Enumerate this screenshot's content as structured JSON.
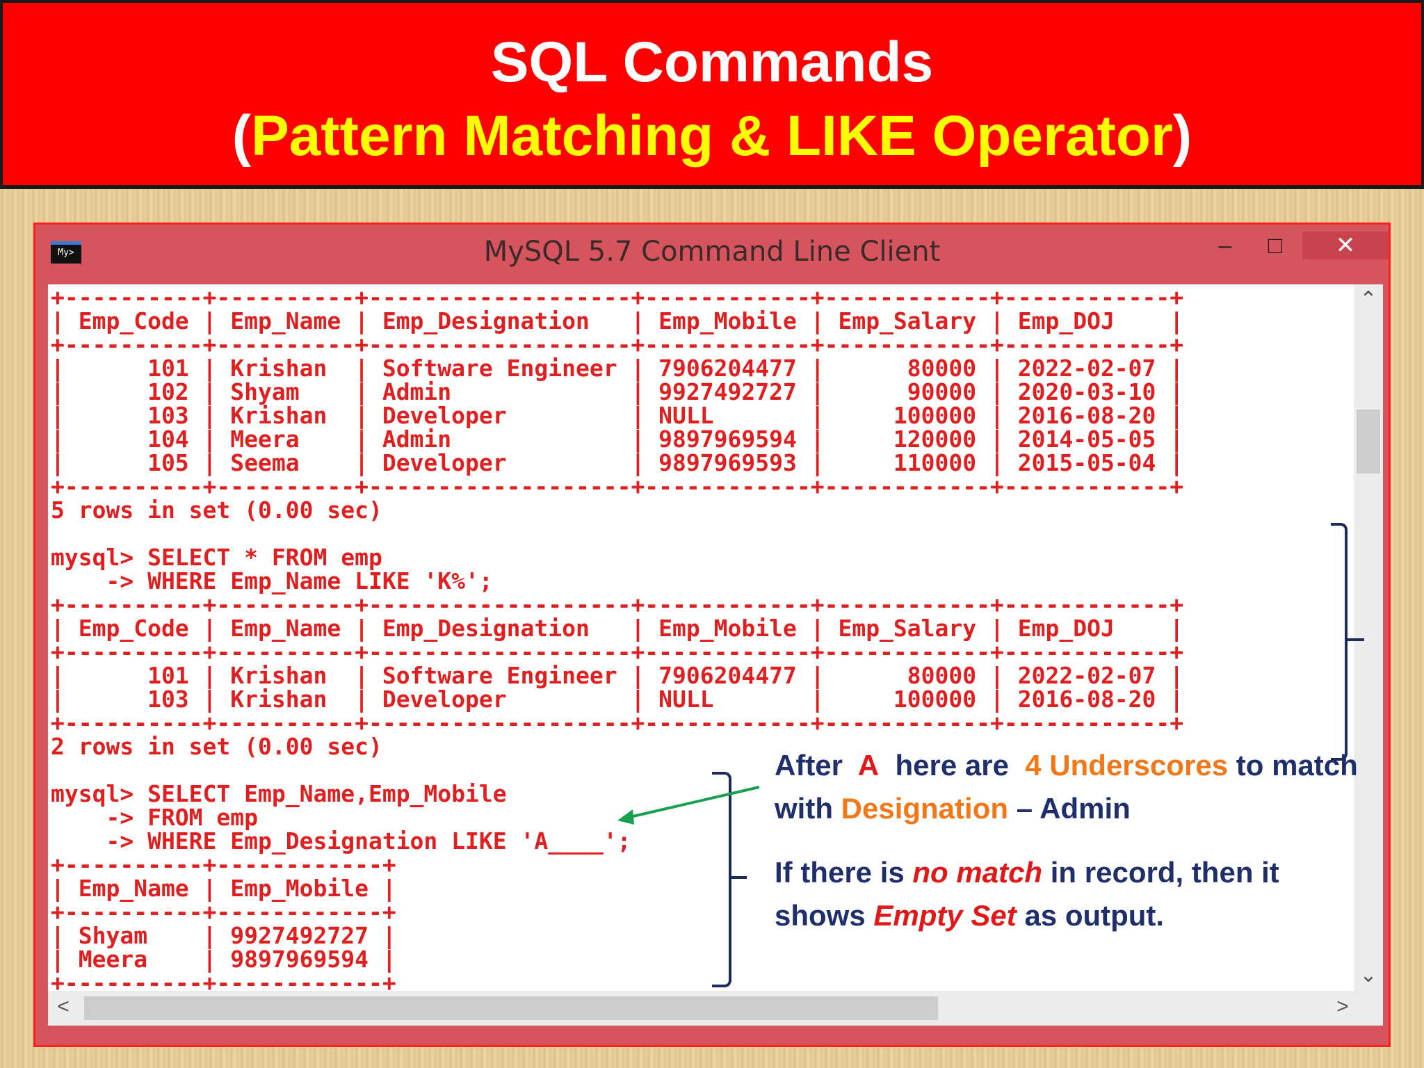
{
  "slide": {
    "title": "SQL Commands",
    "subtitle_open": "(",
    "subtitle_text": "Pattern Matching & LIKE Operator",
    "subtitle_close": ")"
  },
  "window": {
    "title": "MySQL 5.7 Command Line Client",
    "icon_text": "My>",
    "minimize_label": "–",
    "maximize_label": "□",
    "close_label": "✕"
  },
  "console": {
    "table1": {
      "headers": [
        "Emp_Code",
        "Emp_Name",
        "Emp_Designation",
        "Emp_Mobile",
        "Emp_Salary",
        "Emp_DOJ"
      ],
      "rows": [
        [
          "101",
          "Krishan",
          "Software Engineer",
          "7906204477",
          "80000",
          "2022-02-07"
        ],
        [
          "102",
          "Shyam",
          "Admin",
          "9927492727",
          "90000",
          "2020-03-10"
        ],
        [
          "103",
          "Krishan",
          "Developer",
          "NULL",
          "100000",
          "2016-08-20"
        ],
        [
          "104",
          "Meera",
          "Admin",
          "9897969594",
          "120000",
          "2014-05-05"
        ],
        [
          "105",
          "Seema",
          "Developer",
          "9897969593",
          "110000",
          "2015-05-04"
        ]
      ],
      "footer": "5 rows in set (0.00 sec)"
    },
    "query2": [
      "mysql> SELECT * FROM emp",
      "    -> WHERE Emp_Name LIKE 'K%';"
    ],
    "table2": {
      "headers": [
        "Emp_Code",
        "Emp_Name",
        "Emp_Designation",
        "Emp_Mobile",
        "Emp_Salary",
        "Emp_DOJ"
      ],
      "rows": [
        [
          "101",
          "Krishan",
          "Software Engineer",
          "7906204477",
          "80000",
          "2022-02-07"
        ],
        [
          "103",
          "Krishan",
          "Developer",
          "NULL",
          "100000",
          "2016-08-20"
        ]
      ],
      "footer": "2 rows in set (0.00 sec)"
    },
    "query3": [
      "mysql> SELECT Emp_Name,Emp_Mobile",
      "    -> FROM emp",
      "    -> WHERE Emp_Designation LIKE 'A____';"
    ],
    "table3": {
      "headers": [
        "Emp_Name",
        "Emp_Mobile"
      ],
      "rows": [
        [
          "Shyam",
          "9927492727"
        ],
        [
          "Meera",
          "9897969594"
        ]
      ]
    },
    "text_color": "#e02020"
  },
  "annotation": {
    "p1": {
      "t1": "After",
      "t2": "A",
      "t3": "here are",
      "t4": "4 Underscores",
      "t5": "to match with",
      "t6": "Designation",
      "t7": "– Admin"
    },
    "p2": {
      "t1": "If there is",
      "t2": "no match",
      "t3": "in record, then it shows",
      "t4": "Empty Set",
      "t5": "as output."
    }
  },
  "colors": {
    "banner": "#ff0000",
    "subtitle": "#ffff00",
    "note_text": "#1f2f6b",
    "note_red": "#e01818",
    "note_orange": "#f07818",
    "arrow": "#18a050"
  }
}
